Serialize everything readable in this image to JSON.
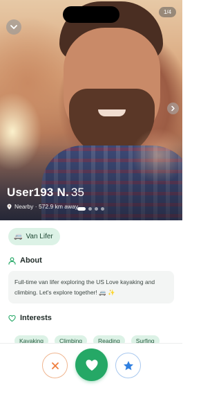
{
  "profile": {
    "name": "User193 N.",
    "age": "35",
    "distance": "Nearby · 572.9 km away",
    "photo_counter": "1/4",
    "photo_count": 4,
    "active_photo": 1
  },
  "lifestyle_tag": {
    "emoji": "🚐",
    "label": "Van Lifer"
  },
  "about": {
    "title": "About",
    "text": "Full-time van lifer exploring the US Love kayaking and climbing. Let's explore together! 🚐 ✨"
  },
  "interests": {
    "title": "Interests",
    "items": [
      "Kayaking",
      "Climbing",
      "Reading",
      "Surfing"
    ]
  },
  "icons": {
    "back": "chevron-down-icon",
    "next": "chevron-right-icon",
    "location": "location-pin-icon",
    "about": "person-icon",
    "interests": "heart-outline-icon",
    "pass": "close-icon",
    "like": "heart-icon",
    "super_like": "star-icon"
  },
  "colors": {
    "accent_green": "#25a866",
    "chip_background": "#dcf2e6",
    "pass_orange": "#ef7d3c",
    "super_like_blue": "#2f7fe0"
  }
}
